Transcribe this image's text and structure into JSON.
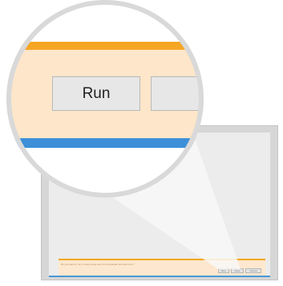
{
  "magnifier": {
    "run_label": "Run"
  },
  "notification": {
    "message": "Do you want to run or save setup.exe from download.microsoft.com?",
    "run_label": "Run",
    "save_label": "Save",
    "cancel_label": "Cancel"
  },
  "colors": {
    "notification_accent": "#f5a623",
    "notification_background": "#fde6c9",
    "selection_accent": "#3d8fd8"
  }
}
